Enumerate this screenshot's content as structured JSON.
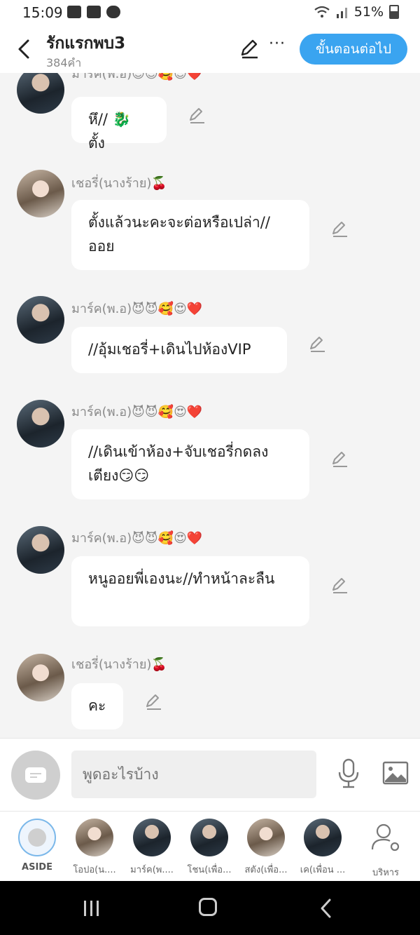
{
  "status_bar": {
    "time": "15:09",
    "battery": "51%"
  },
  "header": {
    "title": "รักแรกพบ3",
    "word_count": "384คำ",
    "next_button": "ขั้นตอนต่อไป",
    "more": "···"
  },
  "messages": [
    {
      "speaker": "มาร์ค(พ.อ)😈😈🥰😍❤️",
      "text": "หึ// 🐉 ตั้ง"
    },
    {
      "speaker": "เชอรี่(นางร้าย)🍒",
      "text": "ตั้งแล้วนะคะจะต่อหรือเปล่า//ออย"
    },
    {
      "speaker": "มาร์ค(พ.อ)😈😈🥰😍❤️",
      "text": "//อุ้มเชอรี่+เดินไปห้องVIP"
    },
    {
      "speaker": "มาร์ค(พ.อ)😈😈🥰😍❤️",
      "text": "//เดินเข้าห้อง+จับเชอรี่กดลงเตียง😏😏"
    },
    {
      "speaker": "มาร์ค(พ.อ)😈😈🥰😍❤️",
      "text": "หนูออยพี่เองนะ//ทำหน้าละลืน"
    },
    {
      "speaker": "เชอรี่(นางร้าย)🍒",
      "text": "คะ"
    }
  ],
  "input": {
    "placeholder": "พูดอะไรบ้าง"
  },
  "characters": [
    {
      "label": "ASIDE"
    },
    {
      "label": "โอปอ(น...."
    },
    {
      "label": "มาร์ค(พ...."
    },
    {
      "label": "โชน(เพื่อ..."
    },
    {
      "label": "สตัง(เพื่อ..."
    },
    {
      "label": "เค(เพื่อน ..."
    },
    {
      "label": "บริหาร"
    }
  ],
  "colors": {
    "accent": "#3aa4f0",
    "bubble": "#ffffff",
    "background": "#f4f4f4"
  }
}
